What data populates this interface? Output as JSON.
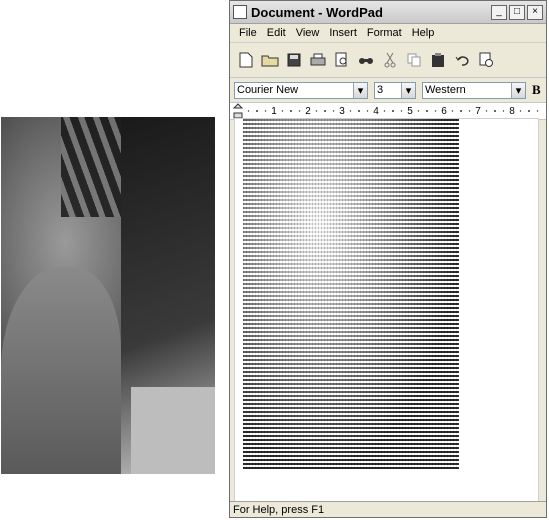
{
  "window": {
    "title": "Document - WordPad",
    "buttons": [
      "minimize",
      "maximize",
      "close"
    ]
  },
  "menu": [
    "File",
    "Edit",
    "View",
    "Insert",
    "Format",
    "Help"
  ],
  "toolbar": {
    "icons": [
      "new-document-icon",
      "open-folder-icon",
      "save-icon",
      "print-icon",
      "print-preview-icon",
      "find-icon",
      "cut-icon",
      "copy-icon",
      "paste-icon",
      "undo-icon",
      "date-time-icon"
    ]
  },
  "format": {
    "font": "Courier New",
    "size": "3",
    "script": "Western",
    "bold_label": "B"
  },
  "ruler": {
    "labels": [
      "1",
      "2",
      "3",
      "4",
      "5",
      "6",
      "7",
      "8"
    ]
  },
  "status": {
    "text": "For Help, press F1"
  }
}
